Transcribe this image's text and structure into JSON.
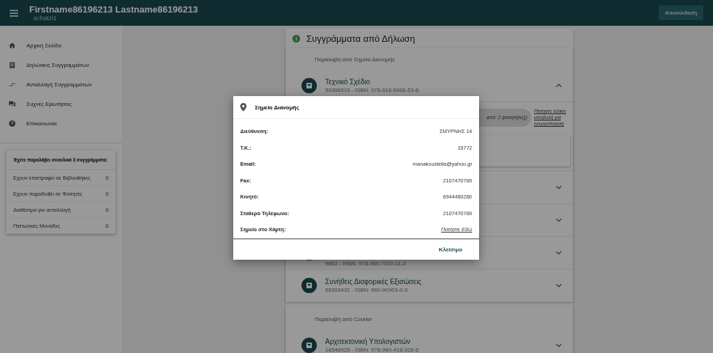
{
  "header": {
    "title": "Firstname86196213 Lastname86196213",
    "subtitle": "achatzi1",
    "logout_button": "Αποσύνδεση"
  },
  "nav": [
    {
      "label": "Αρχική Σελίδα",
      "kind": "home"
    },
    {
      "label": "Δηλώσεις Συγγραμμάτων",
      "kind": "list"
    },
    {
      "label": "Ανταλλαγή Συγγραμμάτων",
      "kind": "swap"
    },
    {
      "label": "Συχνές Ερωτήσεις",
      "kind": "faq"
    },
    {
      "label": "Επικοινωνία",
      "kind": "help"
    }
  ],
  "summary": {
    "title": "Έχετε παραλάβει συνολικά 3 συγγράμματα:",
    "rows": [
      {
        "label": "Εχουν επιστραφεί σε Βιβλιοθήκες",
        "count": "0"
      },
      {
        "label": "Εχουν παραδοθεί σε Φοιτητές",
        "count": "0"
      },
      {
        "label": "Διαθέσιμα για ανταλλαγή",
        "count": "0"
      },
      {
        "label": "Πιστωτικές Μονάδες",
        "count": "0"
      }
    ]
  },
  "section": {
    "title": "Συγγράμματα από Δήλωση",
    "groups": [
      {
        "title": "Παραλαβή από Σημεία Διανομής",
        "books": [
          {
            "title": "Τεχνικό Σχέδιο",
            "subtitle": "59396515 - ISBN: 978-618-5066-53-6",
            "expanded": true,
            "chip": "από: 2 φοιτητή/ες))",
            "link": "Πατηστε τελικη υποβολή για ενεργοποιηση"
          },
          {
            "expanded": false
          },
          {
            "expanded": false
          },
          {
            "subtitle": "9663 - ISBN: 978-960-7310-11-2",
            "expanded": false
          },
          {
            "title": "Συνήθεις Διαφορικές Εξισώσεις",
            "subtitle": "68393432 - ISBN: 960-90903-0-3",
            "expanded": false
          }
        ]
      },
      {
        "title": "Παραλαβή από Courier",
        "books": [
          {
            "title": "Αρχιτεκτονική Υπολογιστών",
            "subtitle": "18548925 - ISBN: 978-960-418-326-5",
            "expanded": false
          }
        ]
      }
    ]
  },
  "dialog": {
    "title": "Σημείο Διανομής",
    "fields": [
      {
        "label": "Διεύθυνση:",
        "value": "ΣΜΥΡΝΗΣ 14",
        "kind": "text"
      },
      {
        "label": "Τ.Κ.:",
        "value": "15772",
        "kind": "text"
      },
      {
        "label": "Email:",
        "value": "manakoustella@yahoo.gr",
        "kind": "text"
      },
      {
        "label": "Fax:",
        "value": "2107470789",
        "kind": "text"
      },
      {
        "label": "Κινητό:",
        "value": "6944460280",
        "kind": "text"
      },
      {
        "label": "Σταθερό Τηλέφωνο:",
        "value": "2107470789",
        "kind": "text"
      },
      {
        "label": "Σημείο στο Χάρτη:",
        "value": "Πατήστε Εδώ",
        "kind": "link"
      }
    ],
    "close_button": "Κλείσιμο"
  }
}
